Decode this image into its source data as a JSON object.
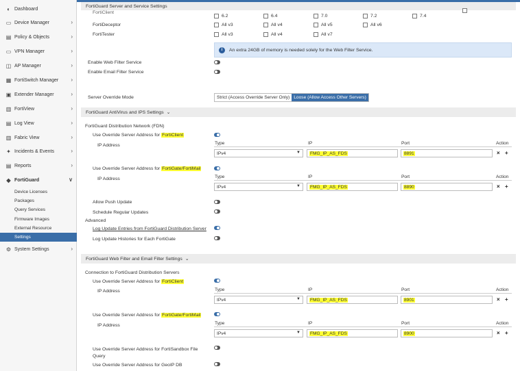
{
  "sidebar": {
    "items": [
      {
        "label": "Dashboard",
        "icon": "dashboard-icon",
        "chev": ""
      },
      {
        "label": "Device Manager",
        "icon": "device-icon",
        "chev": "›"
      },
      {
        "label": "Policy & Objects",
        "icon": "policy-icon",
        "chev": "›"
      },
      {
        "label": "VPN Manager",
        "icon": "vpn-icon",
        "chev": "›"
      },
      {
        "label": "AP Manager",
        "icon": "ap-icon",
        "chev": "›"
      },
      {
        "label": "FortiSwitch Manager",
        "icon": "switch-icon",
        "chev": "›"
      },
      {
        "label": "Extender Manager",
        "icon": "extender-icon",
        "chev": "›"
      },
      {
        "label": "FortiView",
        "icon": "view-icon",
        "chev": "›"
      },
      {
        "label": "Log View",
        "icon": "log-icon",
        "chev": "›"
      },
      {
        "label": "Fabric View",
        "icon": "fabric-icon",
        "chev": "›"
      },
      {
        "label": "Incidents & Events",
        "icon": "incidents-icon",
        "chev": "›"
      },
      {
        "label": "Reports",
        "icon": "reports-icon",
        "chev": "›"
      },
      {
        "label": "FortiGuard",
        "icon": "fortiguard-icon",
        "chev": "∨"
      }
    ],
    "sub_items": [
      "Device Licenses",
      "Packages",
      "Query Services",
      "Firmware Images",
      "External Resource",
      "Settings"
    ],
    "system": {
      "label": "System Settings",
      "chev": "›"
    }
  },
  "header": {
    "title": "FortiGuard Server and Service Settings"
  },
  "top": {
    "forticlient_label": "FortiClient",
    "forticlient_versions": [
      "6.2",
      "6.4",
      "7.0",
      "7.2",
      "7.4"
    ],
    "fortideceptor_label": "FortiDeceptor",
    "fortideceptor_versions": [
      "All v3",
      "All v4",
      "All v5",
      "All v6"
    ],
    "fortitester_label": "FortiTester",
    "fortitester_versions": [
      "All v3",
      "All v4",
      "All v7"
    ]
  },
  "info_text": "An extra 24GB of memory is needed solely for the Web Filter Service.",
  "enable_web_filter": "Enable Web Filter Service",
  "enable_email_filter": "Enable Email Filter Service",
  "override_mode": {
    "label": "Server Override Mode",
    "strict": "Strict (Access Override Server Only)",
    "loose": "Loose (Allow Access Other Servers)"
  },
  "av_section": {
    "title": "FortiGuard AntiVirus and IPS Settings",
    "fdn": "FortiGuard Distribution Network (FDN)",
    "override_prefix": "Use Override Server Address for ",
    "forticlient": "FortiClient",
    "fortigate": "FortiGate/FortiMail",
    "ip_address": "IP Address",
    "col_type": "Type",
    "col_ip": "IP",
    "col_port": "Port",
    "col_action": "Action",
    "row1": {
      "type": "IPv4",
      "ip": "FMG_IP_AS_FDS",
      "port": "8891"
    },
    "row2": {
      "type": "IPv4",
      "ip": "FMG_IP_AS_FDS",
      "port": "8890"
    },
    "allow_push": "Allow Push Update",
    "schedule": "Schedule Regular Updates",
    "advanced": "Advanced",
    "log_entries": "Log Update Entries from FortiGuard Distribution Server",
    "log_histories": "Log Update Histories for Each FortiGate"
  },
  "wf_section": {
    "title": "FortiGuard Web Filter and Email Filter Settings",
    "connection": "Connection to FortiGuard Distribution Servers",
    "row1": {
      "type": "IPv4",
      "ip": "FMG_IP_AS_FDS",
      "port": "8901"
    },
    "row2": {
      "type": "IPv4",
      "ip": "FMG_IP_AS_FDS",
      "port": "8900"
    },
    "sandbox": "Use Override Server Address for FortiSandbox File Query",
    "sandbox_l1": "Use Override Server Address for FortiSandbox File",
    "sandbox_l2": "Query",
    "geoip": "Use Override Server Address for GeoIP DB"
  }
}
